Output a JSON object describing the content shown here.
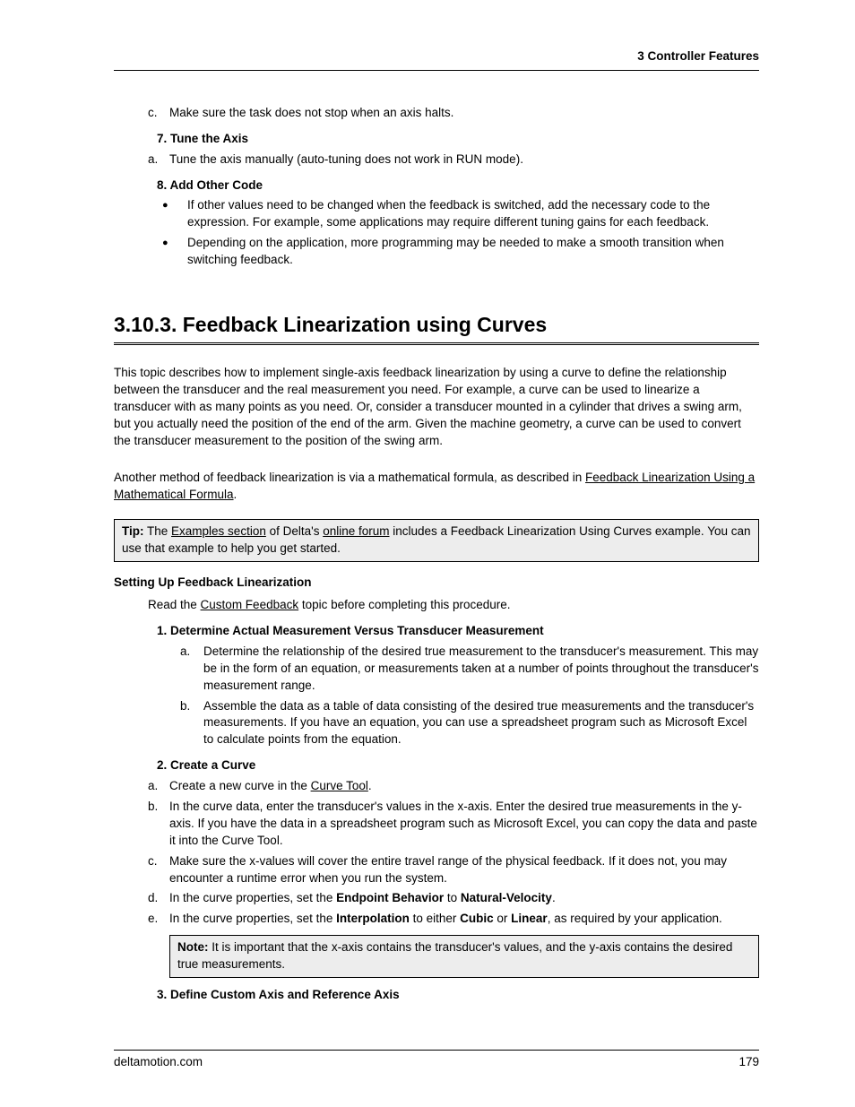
{
  "header": {
    "text": "3  Controller Features"
  },
  "footer": {
    "left": "deltamotion.com",
    "right": "179"
  },
  "top": {
    "item_c": {
      "marker": "c.",
      "text": "Make sure the task does not stop when an axis halts."
    },
    "h7": "7. Tune the Axis",
    "item_7a": {
      "marker": "a.",
      "text": "Tune the axis manually (auto-tuning does not work in RUN mode)."
    },
    "h8": "8. Add Other Code",
    "b1": "If other values need to be changed when the feedback is switched, add the necessary code to the expression. For example, some applications may require different tuning gains for each feedback.",
    "b2": "Depending on the application, more programming may be needed to make a smooth transition when switching feedback."
  },
  "section": {
    "title": "3.10.3. Feedback Linearization using Curves",
    "p1": "This topic describes how to implement single-axis feedback linearization by using a curve to define the relationship between the transducer and the real measurement you need. For example, a curve can be used to linearize a transducer with as many points as you need. Or, consider a transducer mounted in a cylinder that drives a swing arm, but you actually need the position of the end of the arm. Given the machine geometry, a curve can be used to convert the transducer measurement to the position of the swing arm.",
    "p2a": "Another method of feedback linearization is via a mathematical formula, as described in ",
    "p2_link": "Feedback Linearization Using a Mathematical Formula",
    "p2b": ".",
    "tip_label": "Tip:",
    "tip_a": " The ",
    "tip_link1": "Examples section",
    "tip_b": " of Delta's ",
    "tip_link2": "online forum",
    "tip_c": " includes a Feedback Linearization Using Curves example. You can use that example to help you get started.",
    "sub": "Setting Up Feedback Linearization",
    "read_a": "Read the ",
    "read_link": "Custom Feedback",
    "read_b": " topic before completing this procedure.",
    "h1": "1. Determine Actual Measurement Versus Transducer Measurement",
    "s1a": {
      "marker": "a.",
      "text": "Determine the relationship of the desired true measurement to the transducer's measurement. This may be in the form of an equation, or measurements taken at a number of points throughout the transducer's measurement range."
    },
    "s1b": {
      "marker": "b.",
      "text": "Assemble the data as a table of data consisting of the desired true measurements and the transducer's measurements. If you have an equation, you can use a spreadsheet program such as Microsoft Excel to calculate points from the equation."
    },
    "h2": "2. Create a Curve",
    "s2a": {
      "marker": "a.",
      "pre": "Create a new curve in the ",
      "link": "Curve Tool",
      "post": "."
    },
    "s2b": {
      "marker": "b.",
      "text": "In the curve data, enter the transducer's values in the x-axis. Enter the desired true measurements in the y-axis. If you have the data in a spreadsheet program such as Microsoft Excel, you can copy the data and paste it into the Curve Tool."
    },
    "s2c": {
      "marker": "c.",
      "text": "Make sure the x-values will cover the entire travel range of the physical feedback. If it does not, you may encounter a runtime error when you run the system."
    },
    "s2d": {
      "marker": "d.",
      "pre": "In the curve properties, set the ",
      "b1": "Endpoint Behavior",
      "mid": " to ",
      "b2": "Natural-Velocity",
      "post": "."
    },
    "s2e": {
      "marker": "e.",
      "pre": "In the curve properties, set the ",
      "b1": "Interpolation",
      "mid1": " to either ",
      "b2": "Cubic",
      "mid2": " or ",
      "b3": "Linear",
      "post": ", as required by your application."
    },
    "note_label": "Note:",
    "note_text": " It is important that the x-axis contains the transducer's values, and the y-axis contains the desired true measurements.",
    "h3": "3. Define Custom Axis and Reference Axis"
  }
}
